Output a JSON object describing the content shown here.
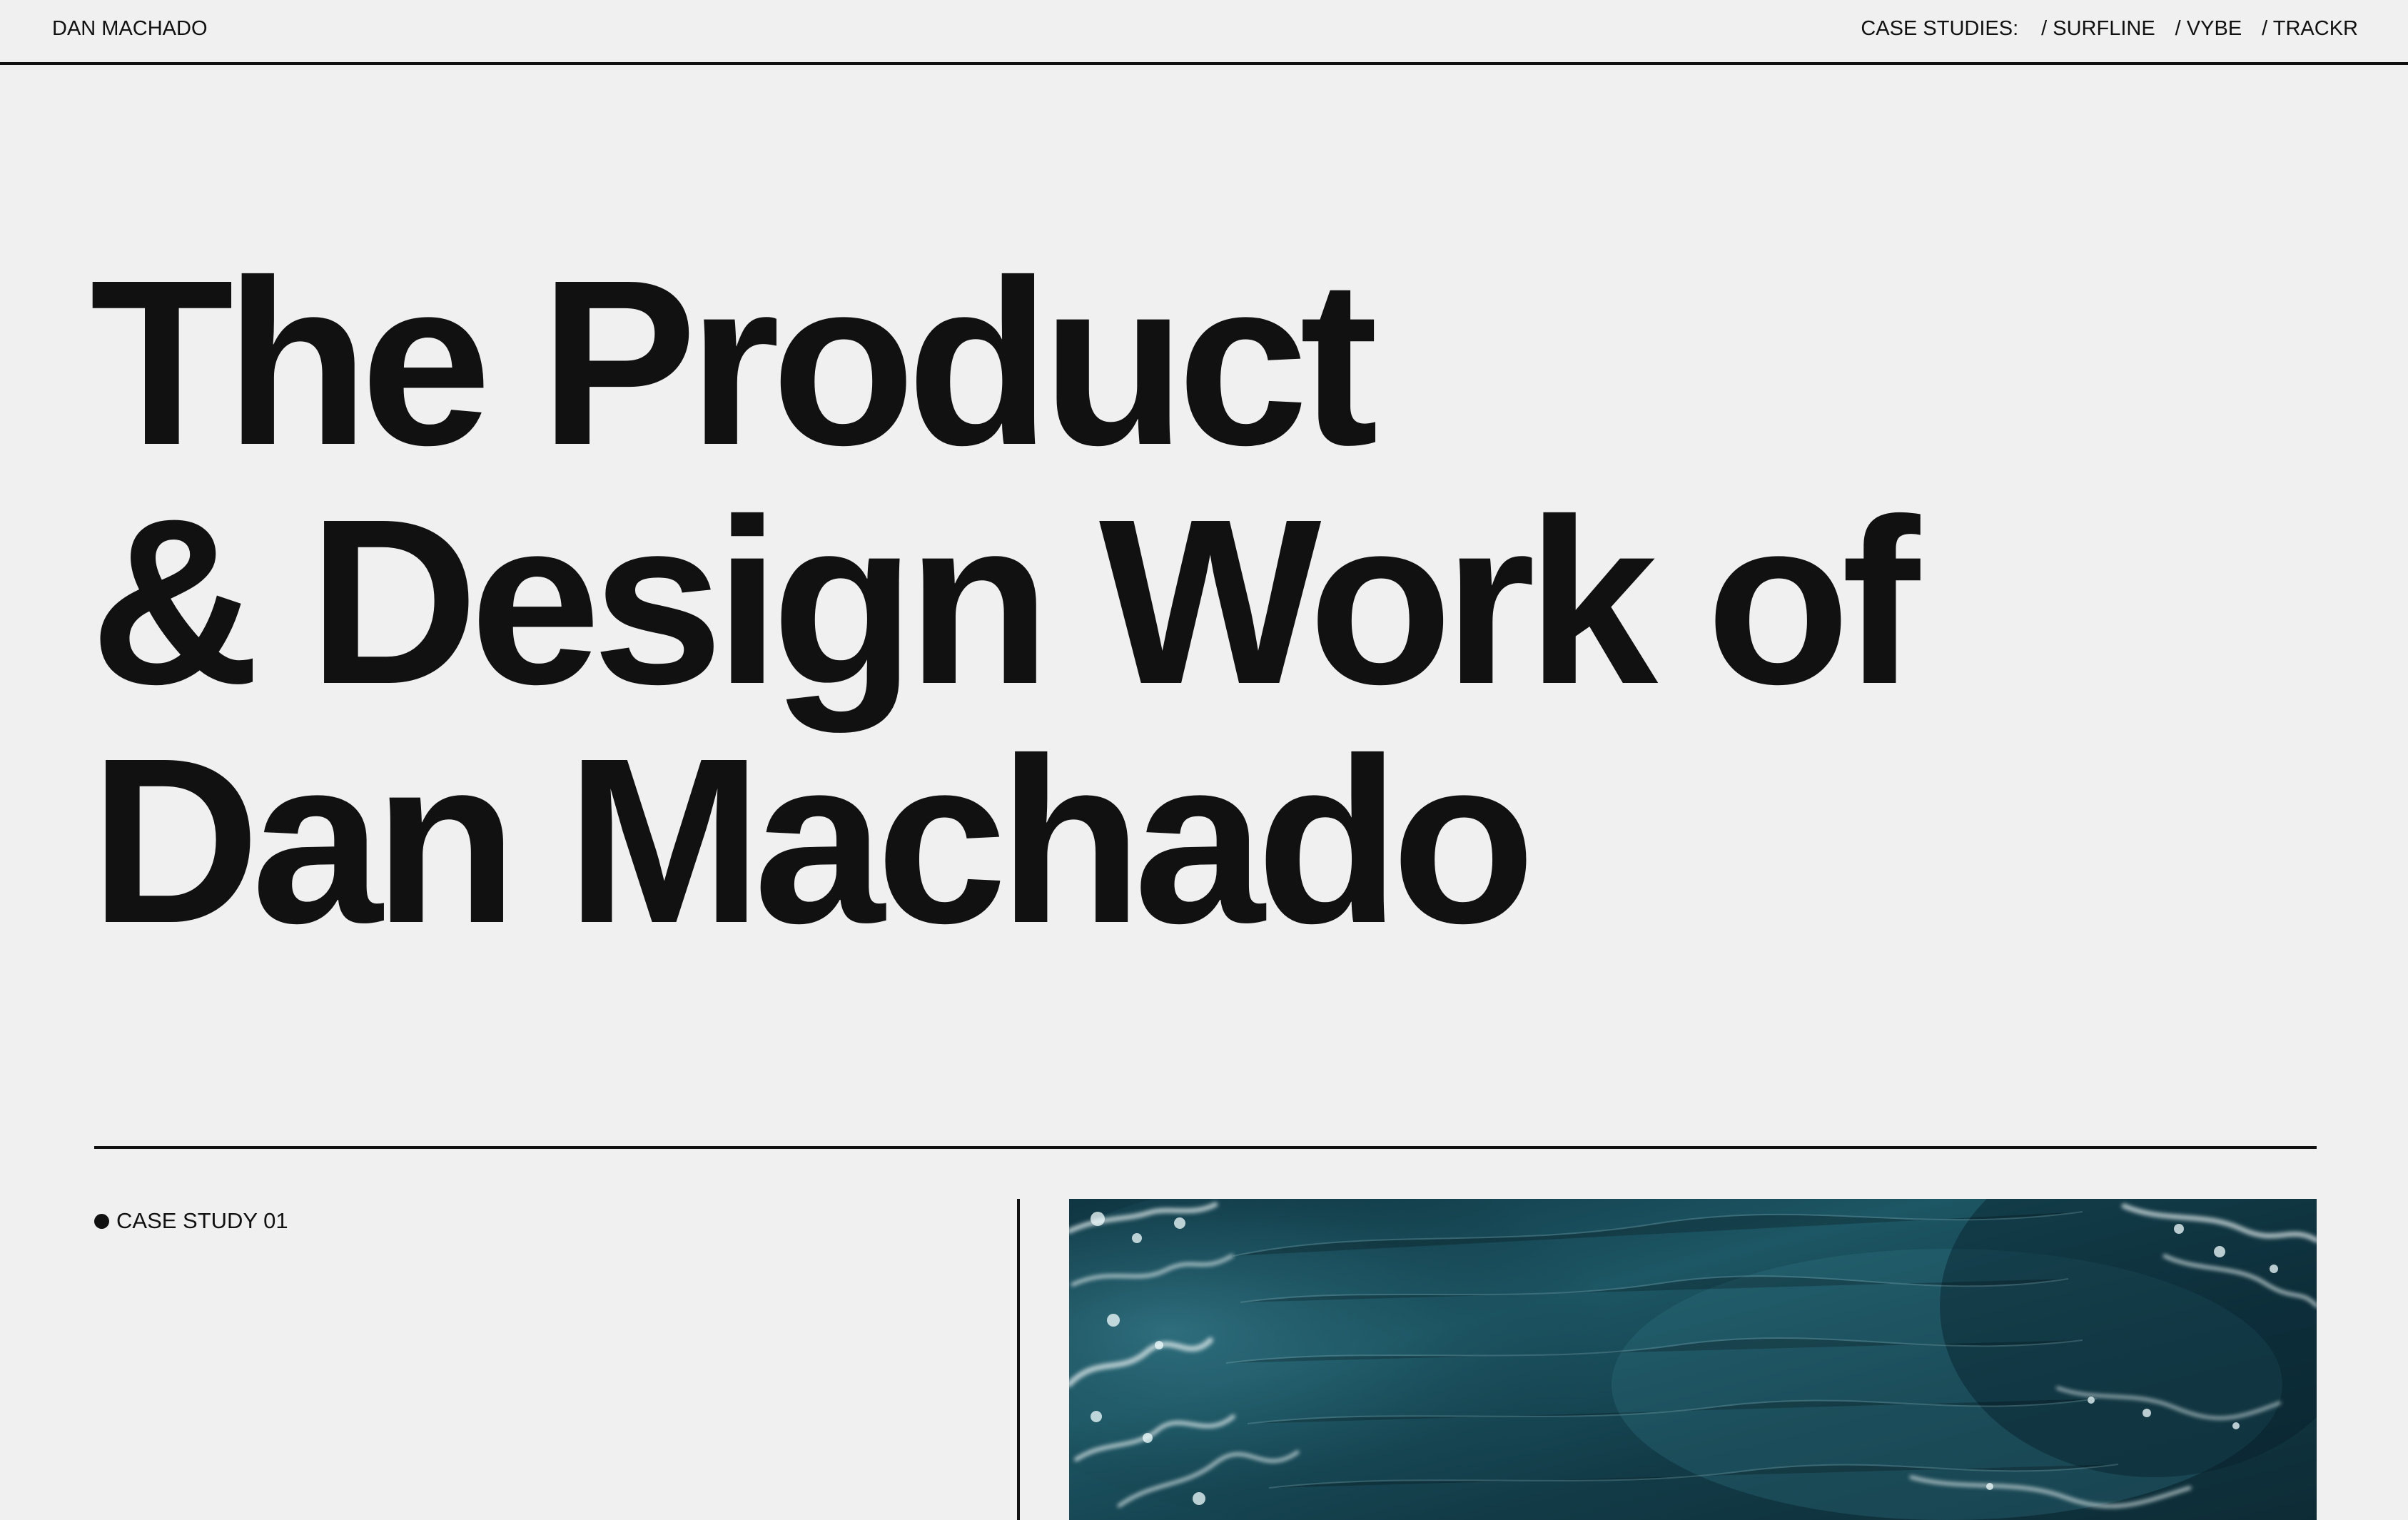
{
  "header": {
    "brand": "DAN MACHADO",
    "case_studies_label": "CASE STUDIES:",
    "links": [
      "/ SURFLINE",
      "/ VYBE",
      "/ TRACKR"
    ]
  },
  "hero": {
    "lines": [
      "The Product",
      "& Design Work of",
      "Dan Machado"
    ]
  },
  "case_study": {
    "label": "CASE STUDY 01"
  },
  "colors": {
    "background": "#f0f0f0",
    "text": "#111111",
    "ocean_dark": "#173f4b",
    "ocean_light": "#2f7180",
    "foam": "#e8f2f2"
  },
  "icons": {
    "bullet": "filled-circle-icon"
  }
}
